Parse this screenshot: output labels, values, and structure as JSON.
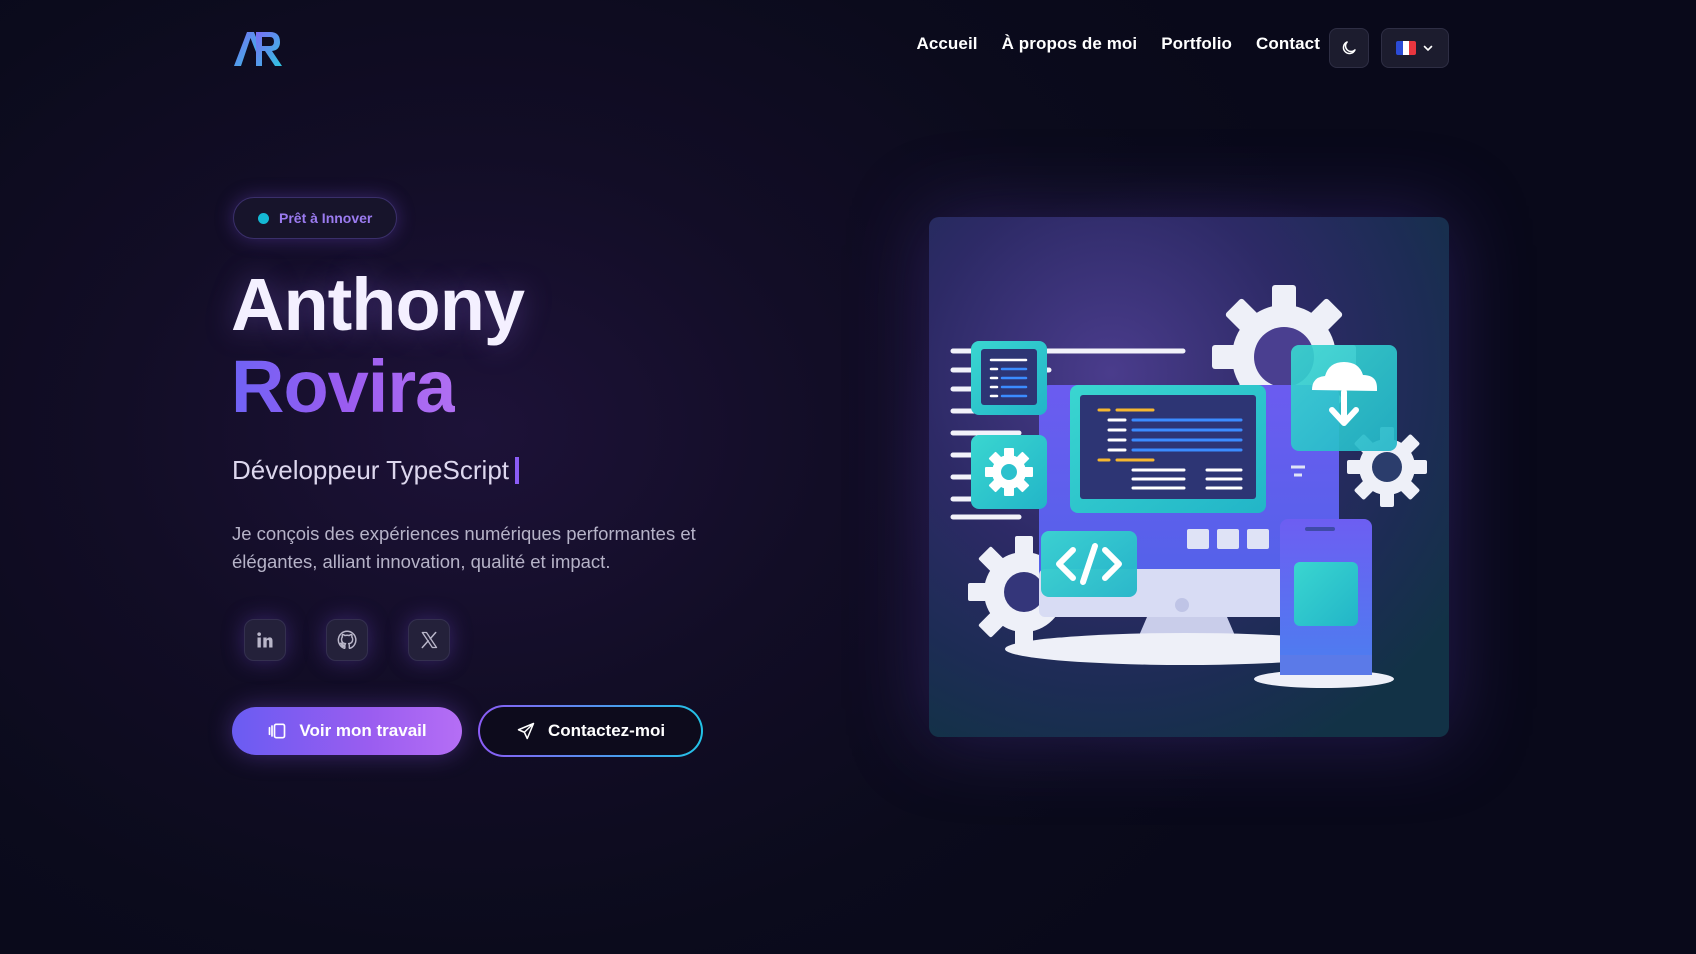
{
  "nav": {
    "logo_text": "AR",
    "links": [
      "Accueil",
      "À propos de moi",
      "Portfolio",
      "Contact"
    ],
    "theme_icon": "moon-icon",
    "language_flag": "fr-flag-icon"
  },
  "hero": {
    "badge": "Prêt à Innover",
    "first_name": "Anthony",
    "last_name": "Rovira",
    "role": "Développeur TypeScript",
    "description": "Je conçois des expériences numériques performantes et élégantes, alliant innovation, qualité et impact.",
    "socials": [
      "linkedin-icon",
      "github-icon",
      "x-icon"
    ],
    "primary_cta": "Voir mon travail",
    "secondary_cta": "Contactez-moi"
  },
  "colors": {
    "accent_start": "#6a5cf2",
    "accent_end": "#b56ef5",
    "teal": "#22c3e6",
    "background": "#0b0b1c"
  }
}
